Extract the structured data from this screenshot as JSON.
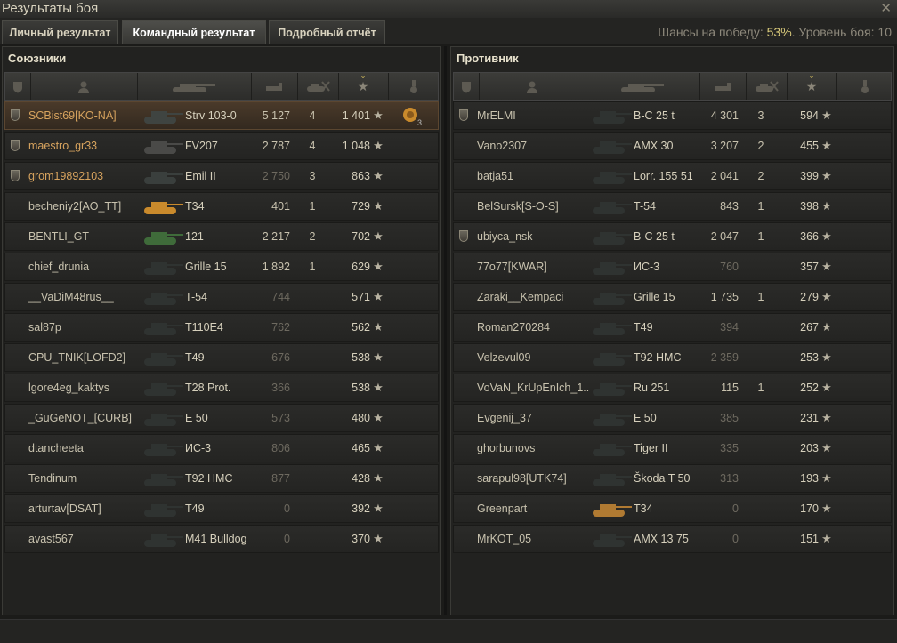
{
  "window": {
    "title": "Результаты боя",
    "close_label": "✕"
  },
  "tabs": [
    {
      "label": "Личный результат",
      "active": false
    },
    {
      "label": "Командный результат",
      "active": true
    },
    {
      "label": "Подробный отчёт",
      "active": false
    }
  ],
  "chances": {
    "label": "Шансы на победу:",
    "value": "53%",
    "level_label": ". Уровень боя:",
    "level_value": "10"
  },
  "allies": {
    "title": "Союзники",
    "rows": [
      {
        "name": "SCBist69[KO-NA]",
        "vehicle": "Strv 103-0",
        "damage": "5 127",
        "frags": "4",
        "xp": "1 401",
        "platoon": true,
        "me": true,
        "tank_color": "#3f4441",
        "medal": true,
        "medal_count": "3"
      },
      {
        "name": "maestro_gr33",
        "vehicle": "FV207",
        "damage": "2 787",
        "frags": "4",
        "xp": "1 048",
        "platoon": true,
        "tank_color": "#4a4a48"
      },
      {
        "name": "grom19892103",
        "vehicle": "Emil II",
        "damage": "2 750",
        "frags": "3",
        "xp": "863",
        "platoon": true,
        "tank_color": "#3a3f3d",
        "dmg_dim": true
      },
      {
        "name": "becheniy2[AO_TT]",
        "vehicle": "T34",
        "damage": "401",
        "frags": "1",
        "xp": "729",
        "tank_color": "#c98a2c"
      },
      {
        "name": "BENTLI_GT",
        "vehicle": "121",
        "damage": "2 217",
        "frags": "2",
        "xp": "702",
        "tank_color": "#3f6b3a"
      },
      {
        "name": "chief_drunia",
        "vehicle": "Grille 15",
        "damage": "1 892",
        "frags": "1",
        "xp": "629",
        "tank_color": "#2f3331"
      },
      {
        "name": "__VaDiM48rus__",
        "vehicle": "T-54",
        "damage": "744",
        "frags": "",
        "xp": "571",
        "tank_color": "#2f3331"
      },
      {
        "name": "sal87p",
        "vehicle": "T110E4",
        "damage": "762",
        "frags": "",
        "xp": "562",
        "tank_color": "#2f3331"
      },
      {
        "name": "CPU_TNIK[LOFD2]",
        "vehicle": "T49",
        "damage": "676",
        "frags": "",
        "xp": "538",
        "tank_color": "#2f3331"
      },
      {
        "name": "lgore4eg_kaktys",
        "vehicle": "T28 Prot.",
        "damage": "366",
        "frags": "",
        "xp": "538",
        "tank_color": "#2f3331"
      },
      {
        "name": "_GuGeNOT_[CURB]",
        "vehicle": "E 50",
        "damage": "573",
        "frags": "",
        "xp": "480",
        "tank_color": "#2f3331"
      },
      {
        "name": "dtancheeta",
        "vehicle": "ИС-3",
        "damage": "806",
        "frags": "",
        "xp": "465",
        "tank_color": "#2f3331"
      },
      {
        "name": "Tendinum",
        "vehicle": "T92 HMC",
        "damage": "877",
        "frags": "",
        "xp": "428",
        "tank_color": "#2f3331"
      },
      {
        "name": "arturtav[DSAT]",
        "vehicle": "T49",
        "damage": "0",
        "frags": "",
        "xp": "392",
        "tank_color": "#2f3331"
      },
      {
        "name": "avast567",
        "vehicle": "M41 Bulldog",
        "damage": "0",
        "frags": "",
        "xp": "370",
        "tank_color": "#2f3331"
      }
    ]
  },
  "enemies": {
    "title": "Противник",
    "rows": [
      {
        "name": "MrELMI",
        "vehicle": "B-C 25 t",
        "damage": "4 301",
        "frags": "3",
        "xp": "594",
        "platoon": true,
        "tank_color": "#2f3331"
      },
      {
        "name": "Vano2307",
        "vehicle": "AMX 30",
        "damage": "3 207",
        "frags": "2",
        "xp": "455",
        "tank_color": "#2f3331"
      },
      {
        "name": "batja51",
        "vehicle": "Lorr. 155 51",
        "damage": "2 041",
        "frags": "2",
        "xp": "399",
        "tank_color": "#2f3331"
      },
      {
        "name": "BelSursk[S-O-S]",
        "vehicle": "T-54",
        "damage": "843",
        "frags": "1",
        "xp": "398",
        "tank_color": "#2f3331"
      },
      {
        "name": "ubiyca_nsk",
        "vehicle": "B-C 25 t",
        "damage": "2 047",
        "frags": "1",
        "xp": "366",
        "platoon": true,
        "tank_color": "#2f3331"
      },
      {
        "name": "77o77[KWAR]",
        "vehicle": "ИС-3",
        "damage": "760",
        "frags": "",
        "xp": "357",
        "tank_color": "#2f3331"
      },
      {
        "name": "Zaraki__Kempaci",
        "vehicle": "Grille 15",
        "damage": "1 735",
        "frags": "1",
        "xp": "279",
        "tank_color": "#2f3331"
      },
      {
        "name": "Roman270284",
        "vehicle": "T49",
        "damage": "394",
        "frags": "",
        "xp": "267",
        "tank_color": "#2f3331"
      },
      {
        "name": "Velzevul09",
        "vehicle": "T92 HMC",
        "damage": "2 359",
        "frags": "",
        "xp": "253",
        "tank_color": "#2f3331"
      },
      {
        "name": "VoVaN_KrUpEnIch_1..",
        "vehicle": "Ru 251",
        "damage": "115",
        "frags": "1",
        "xp": "252",
        "tank_color": "#2f3331"
      },
      {
        "name": "Evgenij_37",
        "vehicle": "E 50",
        "damage": "385",
        "frags": "",
        "xp": "231",
        "tank_color": "#2f3331"
      },
      {
        "name": "ghorbunovs",
        "vehicle": "Tiger II",
        "damage": "335",
        "frags": "",
        "xp": "203",
        "tank_color": "#2f3331"
      },
      {
        "name": "sarapul98[UTK74]",
        "vehicle": "Škoda T 50",
        "damage": "313",
        "frags": "",
        "xp": "193",
        "tank_color": "#2f3331"
      },
      {
        "name": "Greenpart",
        "vehicle": "T34",
        "damage": "0",
        "frags": "",
        "xp": "170",
        "tank_color": "#b07a32"
      },
      {
        "name": "MrKOT_05",
        "vehicle": "AMX 13 75",
        "damage": "0",
        "frags": "",
        "xp": "151",
        "tank_color": "#2f3331"
      }
    ]
  },
  "icons": {
    "star": "★",
    "sort": "⌄"
  }
}
